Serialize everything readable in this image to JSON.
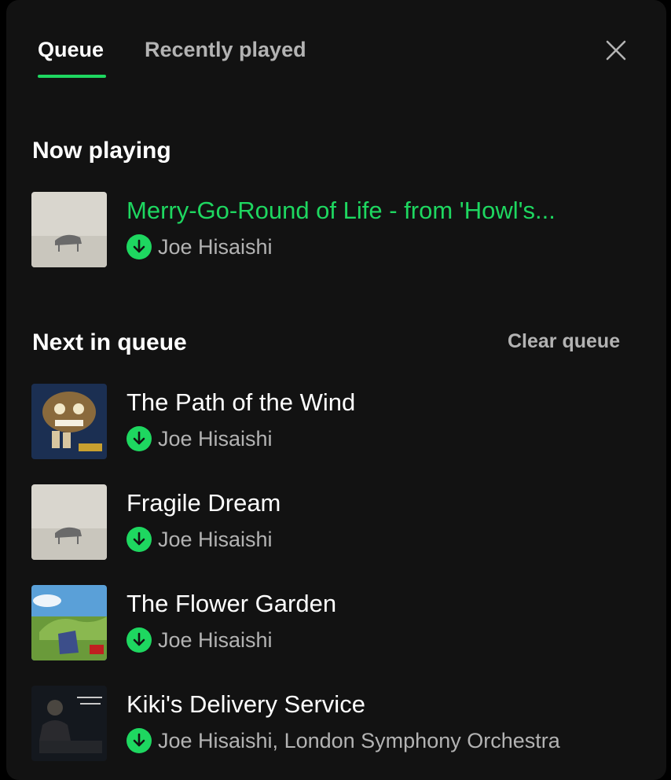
{
  "tabs": [
    {
      "label": "Queue",
      "active": true
    },
    {
      "label": "Recently played",
      "active": false
    }
  ],
  "icons": {
    "close": "close-icon",
    "download": "download-icon"
  },
  "colors": {
    "accent": "#1ed760",
    "background": "#121212",
    "secondary_text": "#b3b3b3"
  },
  "now_playing": {
    "heading": "Now playing",
    "track": {
      "title": "Merry-Go-Round of Life - from 'Howl's...",
      "artist": "Joe Hisaishi",
      "downloaded": true
    }
  },
  "next_in_queue": {
    "heading": "Next in queue",
    "clear_label": "Clear queue",
    "tracks": [
      {
        "title": "The Path of the Wind",
        "artist": "Joe Hisaishi",
        "downloaded": true
      },
      {
        "title": "Fragile Dream",
        "artist": "Joe Hisaishi",
        "downloaded": true
      },
      {
        "title": "The Flower Garden",
        "artist": "Joe Hisaishi",
        "downloaded": true
      },
      {
        "title": "Kiki's Delivery Service",
        "artist": "Joe Hisaishi, London Symphony Orchestra",
        "downloaded": true
      }
    ]
  }
}
